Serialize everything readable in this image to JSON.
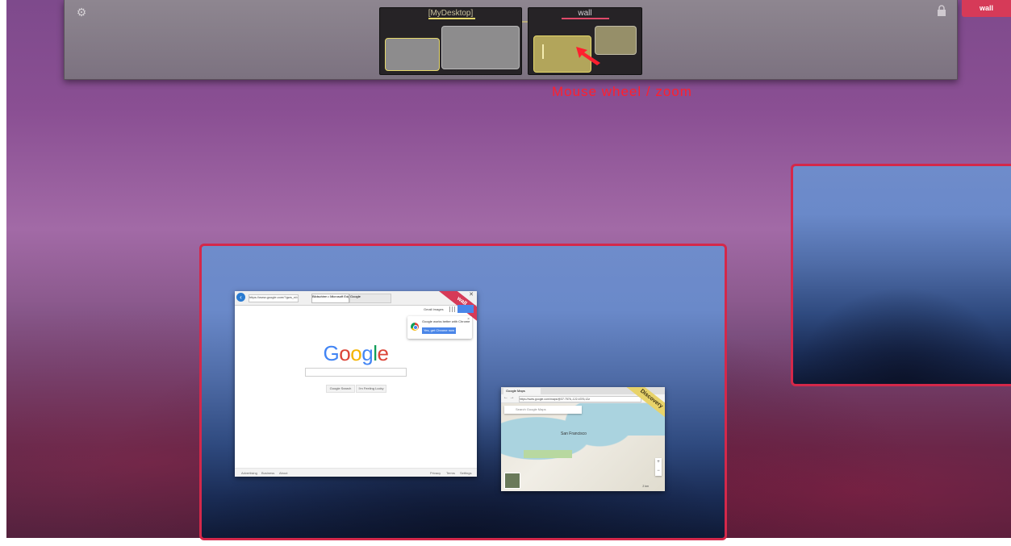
{
  "topbar": {
    "settings_icon": "gear-icon",
    "lock_icon": "lock-icon",
    "desktops": [
      {
        "title": "[MyDesktop]"
      },
      {
        "title": "wall"
      }
    ],
    "active_tab": "wall"
  },
  "annotation": {
    "text": "Mouse wheel / zoom"
  },
  "colors": {
    "accent_red": "#d4284a",
    "highlight_yellow": "#e6d86a"
  },
  "google_window": {
    "url": "https://www.google.com/?gws_rd=ssl",
    "tab1": "Bildschirm • Microsoft Edge",
    "tab2": "Google",
    "ribbon": "wall",
    "header_links": "Gmail  Images",
    "chrome_popup": {
      "message": "Google works better with Chrome",
      "button": "Yes, get Chrome now"
    },
    "logo": [
      "G",
      "o",
      "o",
      "g",
      "l",
      "e"
    ],
    "buttons": [
      "Google Search",
      "I'm Feeling Lucky"
    ],
    "footer_left": [
      "Advertising",
      "Business",
      "About"
    ],
    "footer_right": [
      "Privacy",
      "Terms",
      "Settings"
    ]
  },
  "maps_window": {
    "tab": "Google Maps",
    "url": "https://www.google.com/maps/@37.7576,-122.4376,12z",
    "ribbon": "Discovery",
    "search_placeholder": "Search Google Maps",
    "city_label": "San Francisco",
    "scale": "2 km"
  }
}
